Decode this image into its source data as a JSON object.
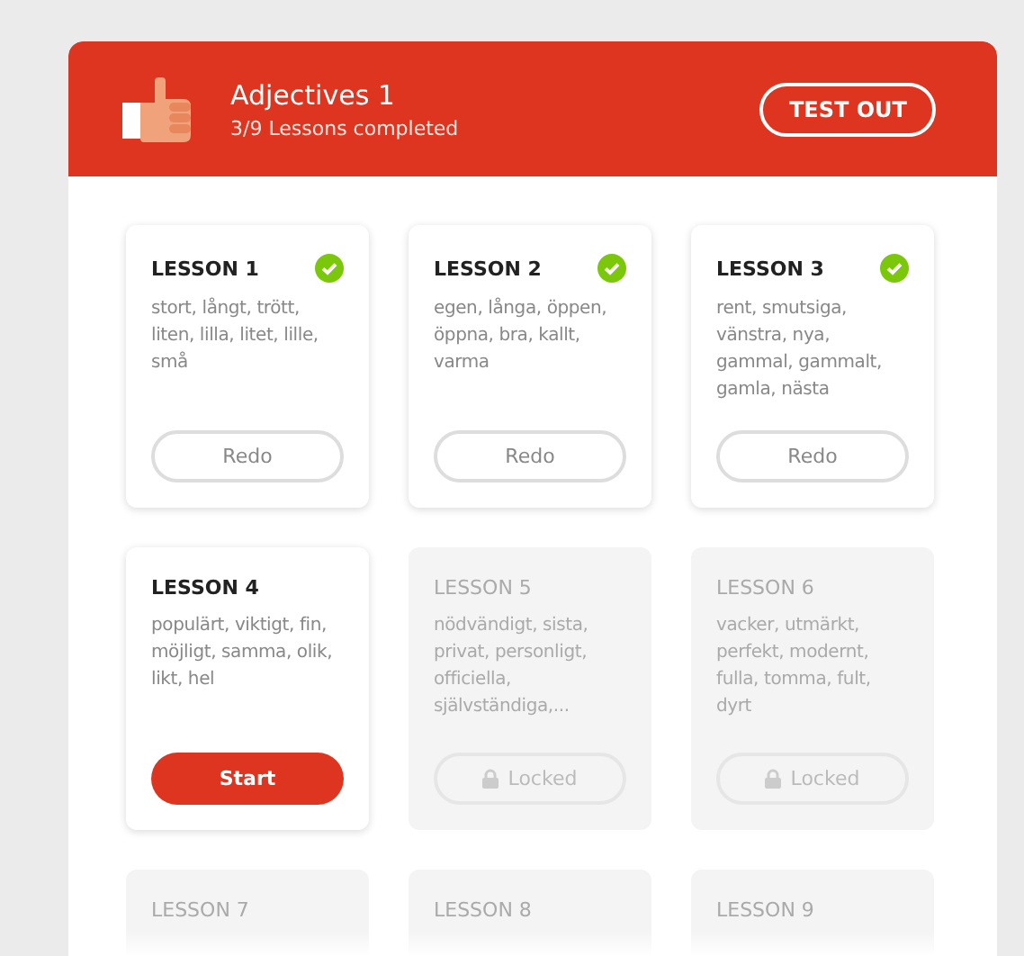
{
  "header": {
    "title": "Adjectives 1",
    "subtitle": "3/9 Lessons completed",
    "button": "TEST OUT"
  },
  "lessons": [
    {
      "title": "LESSON 1",
      "words": "stort, långt, trött, liten, lilla, litet, lille, små",
      "kind": "done",
      "button": "Redo"
    },
    {
      "title": "LESSON 2",
      "words": "egen, långa, öppen, öppna, bra, kallt, varma",
      "kind": "done",
      "button": "Redo"
    },
    {
      "title": "LESSON 3",
      "words": "rent, smutsiga, vänstra, nya, gammal, gammalt, gamla, nästa",
      "kind": "done",
      "button": "Redo"
    },
    {
      "title": "LESSON 4",
      "words": "populärt, viktigt, fin, möjligt, samma, olik, likt, hel",
      "kind": "current",
      "button": "Start"
    },
    {
      "title": "LESSON 5",
      "words": "nödvändigt, sista, privat, personligt, officiella, självständiga,...",
      "kind": "locked",
      "button": "Locked"
    },
    {
      "title": "LESSON 6",
      "words": "vacker, utmärkt, perfekt, modernt, fulla, tomma, fult, dyrt",
      "kind": "locked",
      "button": "Locked"
    },
    {
      "title": "LESSON 7",
      "kind": "locked"
    },
    {
      "title": "LESSON 8",
      "kind": "locked"
    },
    {
      "title": "LESSON 9",
      "kind": "locked"
    }
  ]
}
